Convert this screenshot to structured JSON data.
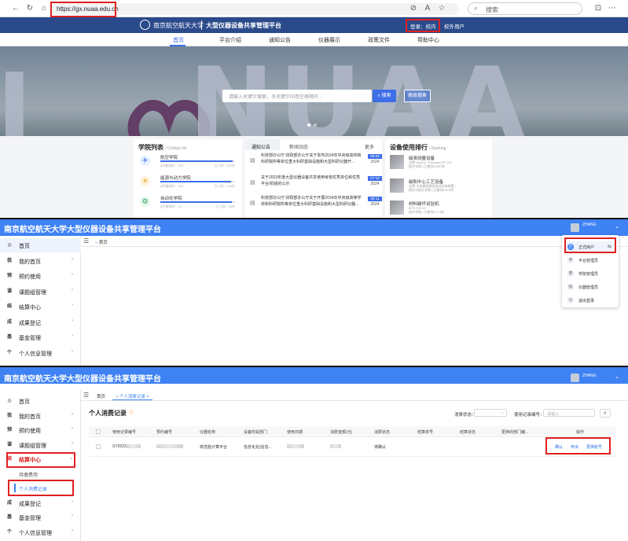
{
  "panel1": {
    "browser": {
      "url": "https://gx.nuaa.edu.cn",
      "search_placeholder": "搜索"
    },
    "site": {
      "logo_text": "南京航空航天大学",
      "title": "大型仪器设备共享管理平台",
      "login_label": "登录：校内",
      "external_login_label": "校外用户",
      "nav": [
        "首页",
        "平台介绍",
        "通知公告",
        "仪器展示",
        "政策文件",
        "帮助中心"
      ],
      "search_placeholder": "请输入关键字搜索，多关键字间用空格隔开...",
      "search_button": "搜索",
      "advanced_button": "高级搜索",
      "hero_text": "NUAA"
    },
    "colleges": {
      "title": "学院列表",
      "subtitle": "/ College list",
      "items": [
        {
          "name": "航空学院",
          "left": "●开放机时：152",
          "right": "已入网：157台",
          "fill": 0.97
        },
        {
          "name": "能源与动力学院",
          "left": "●开放机时：133",
          "right": "已入网：140台",
          "fill": 0.95
        },
        {
          "name": "自动化学院",
          "left": "●开放机时：44",
          "right": "已入网：46台",
          "fill": 0.96
        }
      ]
    },
    "notices": {
      "tabs": [
        "通知公告",
        "新闻动态"
      ],
      "more": "更多",
      "items": [
        {
          "text": "科技部办公厅 财政部办公厅关于发布2024年中央级高校和科研院所等单位重大科研基础设施和大型科研仪器开...",
          "day": "09-09",
          "year": "2024"
        },
        {
          "text": "关于2023年度大型仪器设备共享使用考核优秀单位和优秀平台/机组的公示",
          "day": "07-18",
          "year": "2024"
        },
        {
          "text": "科技部办公厅 财政部办公厅关于开展2024年中央级高等学校和科研院所等单位重大科研基础设施和大型科研仪器...",
          "day": "05-11",
          "year": "2024"
        }
      ]
    },
    "ranking": {
      "title": "设备使用排行",
      "subtitle": "/ Ranking",
      "items": [
        {
          "name": "磁滞测量设备",
          "line1": "品牌 Oxford / Tessarion PT 121",
          "line2": "航空学院 | 已使用130小时"
        },
        {
          "name": "磁和中心工艺设备",
          "line1": "品牌·主机精密微机测试系统装置 ?",
          "line2": "航空与航天学院 | 已使用441.8时"
        },
        {
          "name": "材料破坏试验机",
          "line1": "MTS 370.10",
          "line2": "航空学院 | 已使用377.9时"
        }
      ]
    }
  },
  "panel2": {
    "app_title": "南京航空航天大学大型仪器设备共享管理平台",
    "user_name": "ZHANG",
    "tab_home": "首页",
    "sidebar": [
      {
        "icon": "◎",
        "label": "首页",
        "active": true
      },
      {
        "icon": "我",
        "label": "我的首页",
        "caret": "›"
      },
      {
        "icon": "预",
        "label": "预约使用",
        "caret": "›"
      },
      {
        "icon": "课",
        "label": "课题组管理",
        "caret": "›"
      },
      {
        "icon": "结",
        "label": "结算中心",
        "caret": "›"
      },
      {
        "icon": "成",
        "label": "成果登记",
        "caret": "›"
      },
      {
        "icon": "基",
        "label": "基金管理",
        "caret": "›"
      },
      {
        "icon": "个",
        "label": "个人信息管理",
        "caret": "›"
      }
    ],
    "dropdown": [
      {
        "icon": "正",
        "label": "正式用户",
        "extra": "⇆"
      },
      {
        "icon": "平",
        "label": "平台管理员"
      },
      {
        "icon": "学",
        "label": "学院管理员"
      },
      {
        "icon": "仪",
        "label": "仪器管理员"
      },
      {
        "icon": "⏻",
        "label": "退出登录"
      }
    ]
  },
  "panel3": {
    "app_title": "南京航空航天大学大型仪器设备共享管理平台",
    "user_name": "ZHANG",
    "tabs": [
      "首页",
      "个人消费记录"
    ],
    "tab_close": "×",
    "sidebar": [
      {
        "icon": "◎",
        "label": "首页"
      },
      {
        "icon": "我",
        "label": "我的首页",
        "caret": "›"
      },
      {
        "icon": "预",
        "label": "预约使用",
        "caret": "›"
      },
      {
        "icon": "课",
        "label": "课题组管理",
        "caret": "›"
      },
      {
        "icon": "结",
        "label": "结算中心",
        "caret": "⌄"
      },
      {
        "icon": "",
        "label": "待缴费用"
      },
      {
        "icon": "",
        "label": "个人消费记录"
      },
      {
        "icon": "成",
        "label": "成果登记",
        "caret": "›"
      },
      {
        "icon": "基",
        "label": "基金管理",
        "caret": "›"
      },
      {
        "icon": "个",
        "label": "个人信息管理",
        "caret": "›"
      }
    ],
    "page_title": "个人消费记录",
    "star": "☆",
    "filter": {
      "status_label": "消费状态：",
      "record_label": "使用记录编号：",
      "record_placeholder": "请输入",
      "search_icon": "⌕"
    },
    "table": {
      "headers": [
        "使用记录编号",
        "预约编号",
        "仪器名称",
        "设备所属部门",
        "使用日期",
        "消费金额(元)",
        "消费状态",
        "结算单号",
        "结算状态",
        "更换的部门编...",
        "操作"
      ],
      "row": {
        "record_no": "SY2023",
        "instrument": "高性能计算平台",
        "dept": "信息化处(信息...",
        "status": "待确认",
        "ops": [
          "确认",
          "申诉",
          "更换账号"
        ]
      }
    }
  }
}
